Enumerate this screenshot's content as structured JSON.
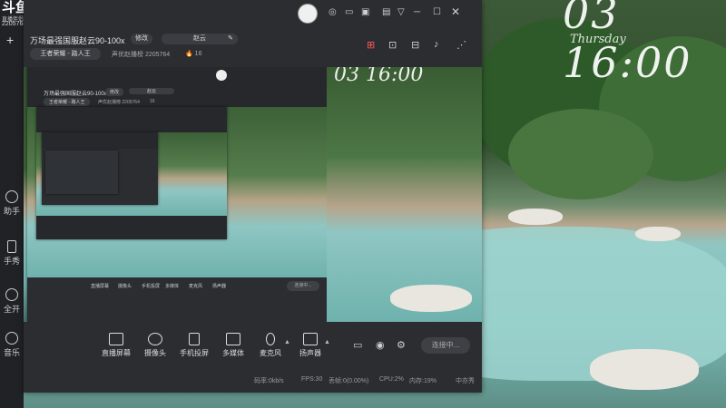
{
  "wallpaper": {
    "clock": "03 16:00",
    "weekday": "Thursday"
  },
  "left_strip": {
    "logo_big": "斗鱼",
    "logo_small": "直播伴侣",
    "room_id": "2205764",
    "add_label": "+",
    "items": [
      {
        "icon": "circle-icon",
        "label": "助手"
      },
      {
        "icon": "phone-icon",
        "label": "手秀"
      },
      {
        "icon": "location-icon",
        "label": "全开"
      },
      {
        "icon": "sound-icon",
        "label": "音乐"
      }
    ]
  },
  "window": {
    "title": "万场最强国服赵云90-100x",
    "edit_label": "修改",
    "category_value": "赵云",
    "game_value": "王者荣耀 - 路人王",
    "room_label": "声优赵播榜",
    "room_id": "2205764",
    "hot_count": "16",
    "window_icons": [
      "support-icon",
      "message-icon",
      "screen-icon",
      "save-icon",
      "filter-icon",
      "minimize-icon",
      "maximize-icon",
      "close-icon"
    ],
    "toolbar_icons": [
      "gift-icon",
      "unlock-icon",
      "share-screen-icon",
      "bell-icon",
      "share-icon"
    ],
    "controls": [
      {
        "icon": "screen-share-icon",
        "label": "直播屏幕"
      },
      {
        "icon": "camera-icon",
        "label": "摄像头"
      },
      {
        "icon": "phone-cast-icon",
        "label": "手机投屏"
      },
      {
        "icon": "media-icon",
        "label": "多媒体"
      },
      {
        "icon": "mic-icon",
        "label": "麦克风"
      },
      {
        "icon": "speaker-icon",
        "label": "扬声器"
      }
    ],
    "connect_label": "连接中...",
    "status": {
      "bitrate": "码率:0kb/s",
      "fps": "FPS:30",
      "dropped": "丢帧:0(0.00%)",
      "cpu": "CPU:2%",
      "memory": "内存:19%",
      "weather": "中亦秀"
    }
  },
  "nested_preview": {
    "title": "万场最强国服赵云90-100x",
    "edit_label": "修改",
    "category_value": "赵云",
    "game_value": "王者荣耀 - 路人王",
    "room_label": "声优赵播榜",
    "room_id": "2205764",
    "hot_count": "16",
    "connect_label": "连接中...",
    "controls": [
      "直播屏幕",
      "摄像头",
      "手机投屏",
      "多媒体",
      "麦克风",
      "扬声器"
    ]
  }
}
